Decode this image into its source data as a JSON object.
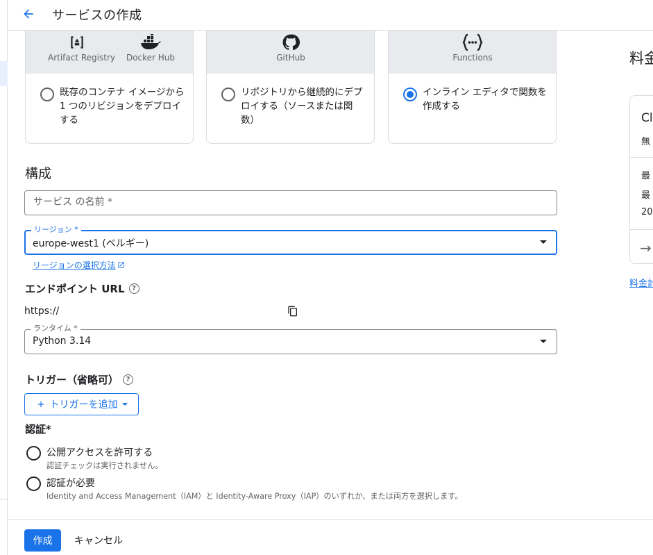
{
  "header": {
    "title": "サービスの作成"
  },
  "cards": [
    {
      "logos": [
        {
          "icon": "artifact-registry-icon",
          "label": "Artifact Registry"
        },
        {
          "icon": "docker-hub-icon",
          "label": "Docker Hub"
        }
      ],
      "description": "既存のコンテナ イメージから 1 つのリビジョンをデプロイする",
      "selected": false
    },
    {
      "logos": [
        {
          "icon": "github-icon",
          "label": "GitHub"
        }
      ],
      "description": "リポジトリから継続的にデプロイする（ソースまたは関数）",
      "selected": false
    },
    {
      "logos": [
        {
          "icon": "functions-icon",
          "label": "Functions"
        }
      ],
      "description": "インライン エディタで関数を作成する",
      "selected": true
    }
  ],
  "config": {
    "title": "構成",
    "service_name_placeholder": "サービス の名前 *",
    "region_label": "リージョン *",
    "region_value": "europe-west1 (ベルギー)",
    "region_help_link": "リージョンの選択方法",
    "endpoint_title": "エンドポイント URL",
    "endpoint_value": "https://",
    "runtime_label": "ランタイム *",
    "runtime_value": "Python 3.14"
  },
  "trigger": {
    "title": "トリガー（省略可）",
    "add_button": "トリガーを追加"
  },
  "auth": {
    "title": "認証*",
    "options": [
      {
        "label": "公開アクセスを許可する",
        "sub": "認証チェックは実行されません。"
      },
      {
        "label": "認証が必要",
        "sub": "Identity and Access Management（IAM）と Identity-Aware Proxy（IAP）のいずれか、または両方を選択します。"
      }
    ]
  },
  "footer": {
    "create": "作成",
    "cancel": "キャンセル"
  },
  "right_panel": {
    "title": "料金",
    "card_title": "Cl",
    "card_sub": "無",
    "row1": "最",
    "row2": "最",
    "row3": "20",
    "link": "料金計"
  },
  "colors": {
    "accent": "#1a73e8",
    "band": "#e8eaed"
  }
}
